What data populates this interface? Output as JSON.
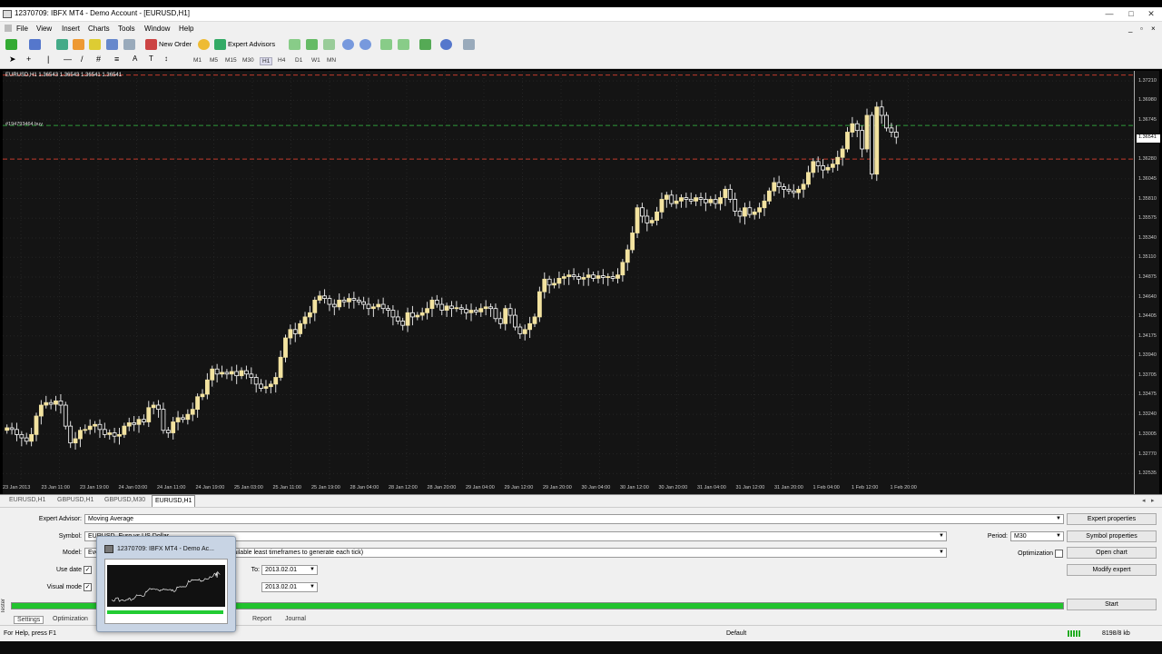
{
  "window": {
    "title": "12370709: IBFX MT4 - Demo Account - [EURUSD,H1]",
    "buttons": [
      "—",
      "□",
      "✕"
    ]
  },
  "menu": [
    "File",
    "View",
    "Insert",
    "Charts",
    "Tools",
    "Window",
    "Help"
  ],
  "toolbar": {
    "new_order": "New Order",
    "expert_advisors": "Expert Advisors",
    "timeframes": [
      "M1",
      "M5",
      "M15",
      "M30",
      "H1",
      "H4",
      "D1",
      "W1",
      "MN"
    ],
    "active_timeframe": "H1",
    "text_tool": "A"
  },
  "chart": {
    "info": "EURUSD,H1  1.36543 1.36543 1.36541 1.36541",
    "order_label": "#194793464 buy",
    "current_price": "1.36541",
    "background": "#141414",
    "bull_color": "#f3e3a0",
    "bear_color": "#ffffff",
    "stop_line_color": "#c0392b",
    "order_line_color": "#2e9b3a"
  },
  "chart_data": {
    "type": "candlestick",
    "symbol": "EURUSD",
    "timeframe": "H1",
    "y_ticks": [
      "1.37210",
      "1.36980",
      "1.36745",
      "1.36515",
      "1.36280",
      "1.36045",
      "1.35810",
      "1.35575",
      "1.35340",
      "1.35110",
      "1.34875",
      "1.34640",
      "1.34405",
      "1.34175",
      "1.33940",
      "1.33705",
      "1.33475",
      "1.33240",
      "1.33005",
      "1.32770",
      "1.32535"
    ],
    "x_ticks": [
      "23 Jan 2013",
      "23 Jan 11:00",
      "23 Jan 19:00",
      "24 Jan 03:00",
      "24 Jan 11:00",
      "24 Jan 19:00",
      "25 Jan 03:00",
      "25 Jan 11:00",
      "25 Jan 19:00",
      "28 Jan 04:00",
      "28 Jan 12:00",
      "28 Jan 20:00",
      "29 Jan 04:00",
      "29 Jan 12:00",
      "29 Jan 20:00",
      "30 Jan 04:00",
      "30 Jan 12:00",
      "30 Jan 20:00",
      "31 Jan 04:00",
      "31 Jan 12:00",
      "31 Jan 20:00",
      "1 Feb 04:00",
      "1 Feb 12:00",
      "1 Feb 20:00"
    ],
    "ylim": [
      1.3242,
      1.3733
    ],
    "levels": {
      "stop_loss": 1.3728,
      "order": 1.3668,
      "take_profit": 1.3628
    },
    "closes": [
      1.3308,
      1.3306,
      1.33,
      1.3296,
      1.3292,
      1.33,
      1.3322,
      1.3335,
      1.3338,
      1.3336,
      1.334,
      1.3335,
      1.331,
      1.329,
      1.3295,
      1.3305,
      1.3306,
      1.331,
      1.3312,
      1.3306,
      1.33,
      1.3302,
      1.3298,
      1.33,
      1.331,
      1.3314,
      1.3312,
      1.3318,
      1.3315,
      1.3332,
      1.3335,
      1.333,
      1.3305,
      1.3302,
      1.3315,
      1.332,
      1.3318,
      1.3324,
      1.333,
      1.3345,
      1.3348,
      1.3365,
      1.3378,
      1.3372,
      1.3374,
      1.3372,
      1.3375,
      1.337,
      1.3376,
      1.3372,
      1.3368,
      1.336,
      1.3355,
      1.3357,
      1.336,
      1.3368,
      1.3392,
      1.3415,
      1.3425,
      1.342,
      1.3432,
      1.344,
      1.3445,
      1.346,
      1.3465,
      1.3462,
      1.3455,
      1.3452,
      1.346,
      1.3458,
      1.3462,
      1.346,
      1.3458,
      1.3455,
      1.345,
      1.3452,
      1.3455,
      1.345,
      1.3448,
      1.344,
      1.3435,
      1.343,
      1.3445,
      1.344,
      1.3442,
      1.3445,
      1.345,
      1.346,
      1.3455,
      1.3448,
      1.3453,
      1.345,
      1.3451,
      1.3449,
      1.3445,
      1.3448,
      1.3446,
      1.345,
      1.3452,
      1.345,
      1.3438,
      1.3432,
      1.345,
      1.3442,
      1.3428,
      1.342,
      1.3425,
      1.3432,
      1.344,
      1.347,
      1.3485,
      1.3478,
      1.348,
      1.3486,
      1.3488,
      1.349,
      1.3488,
      1.3485,
      1.3487,
      1.349,
      1.3486,
      1.3489,
      1.3487,
      1.3488,
      1.3486,
      1.349,
      1.3505,
      1.352,
      1.354,
      1.357,
      1.356,
      1.3552,
      1.3555,
      1.3565,
      1.358,
      1.3585,
      1.3575,
      1.3578,
      1.3582,
      1.358,
      1.3578,
      1.3582,
      1.358,
      1.3576,
      1.358,
      1.3575,
      1.3582,
      1.3592,
      1.358,
      1.3566,
      1.356,
      1.357,
      1.3562,
      1.3565,
      1.357,
      1.3578,
      1.359,
      1.36,
      1.3595,
      1.3592,
      1.359,
      1.3588,
      1.3592,
      1.3598,
      1.3612,
      1.3625,
      1.362,
      1.3615,
      1.3618,
      1.3622,
      1.363,
      1.364,
      1.366,
      1.367,
      1.3662,
      1.364,
      1.368,
      1.361,
      1.369,
      1.368,
      1.3665,
      1.366,
      1.3654
    ]
  },
  "chart_tabs": [
    "EURUSD,H1",
    "GBPUSD,H1",
    "GBPUSD,M30",
    "EURUSD,H1"
  ],
  "active_chart_tab": 3,
  "tester": {
    "expert_advisor_label": "Expert Advisor:",
    "expert_advisor_value": "Moving Average",
    "symbol_label": "Symbol:",
    "symbol_value": "EURUSD, Euro vs US Dollar",
    "model_label": "Model:",
    "model_value": "Every tick (the most precise method based on all available least timeframes to generate each tick)",
    "use_date_label": "Use date",
    "visual_mode_label": "Visual mode",
    "to_label": "To:",
    "to_value": "2013.02.01",
    "skip_to_value": "2013.02.01",
    "period_label": "Period:",
    "period_value": "M30",
    "optimization_label": "Optimization",
    "buttons": {
      "expert_properties": "Expert properties",
      "symbol_properties": "Symbol properties",
      "open_chart": "Open chart",
      "modify_expert": "Modify expert",
      "start": "Start"
    },
    "tabs": [
      "Settings",
      "Optimization",
      "Report",
      "Journal"
    ],
    "side_label": "Tester",
    "progress_color": "#22c32e"
  },
  "status": {
    "help": "For Help, press F1",
    "profile": "Default",
    "traffic": "8198/8 kb"
  },
  "thumbnail": {
    "title": "12370709: IBFX MT4 - Demo Ac..."
  }
}
